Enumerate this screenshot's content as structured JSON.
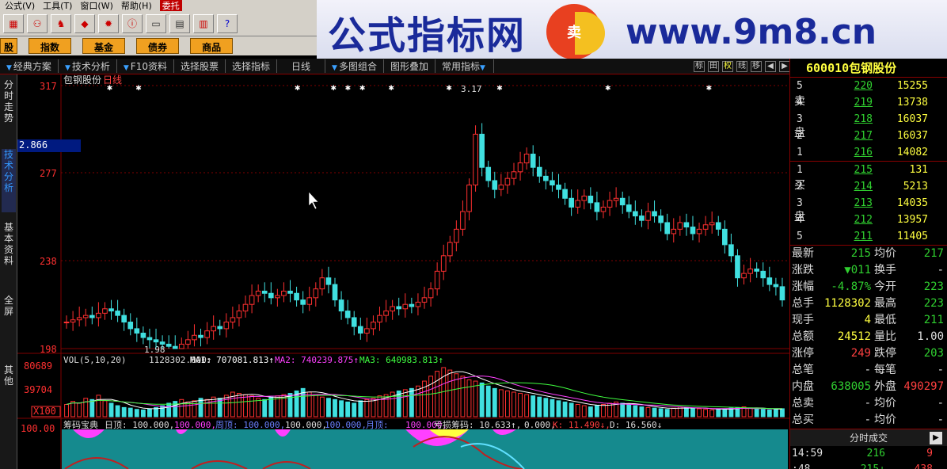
{
  "menubar": {
    "items": [
      "公式(V)",
      "工具(T)",
      "窗口(W)",
      "帮助(H)"
    ],
    "highlight": "委托"
  },
  "toolbar": {
    "icons": [
      "grid-icon",
      "binoculars-icon",
      "stock-icon",
      "diamond-icon",
      "sun-icon",
      "info-icon",
      "window-icon",
      "layout-icon",
      "books-icon",
      "help-cursor-icon"
    ]
  },
  "quickbar": {
    "buttons": [
      "股",
      "指数",
      "基金",
      "债券",
      "商品"
    ]
  },
  "banner": {
    "title": "公式指标网",
    "logo_text": "卖",
    "url": "www.9m8.cn"
  },
  "tabs": [
    "经典方案",
    "技术分析",
    "F10资料",
    "选择股票",
    "选择指标",
    "日线",
    "多图组合",
    "图形叠加",
    "常用指标"
  ],
  "tab_buttons": [
    "标",
    "田",
    "权",
    "线",
    "移"
  ],
  "sidenav": [
    {
      "label": "分时走势",
      "active": false
    },
    {
      "label": "技术分析",
      "active": true
    },
    {
      "label": "基本资料",
      "active": false
    },
    {
      "label": "全屏",
      "active": false
    },
    {
      "label": "其他",
      "active": false
    }
  ],
  "chart": {
    "stock_name": "包钢股份",
    "period": "日线",
    "cursor_value": "2.866",
    "price_axis": [
      "317",
      "277",
      "238",
      "198"
    ],
    "high_label": "3.17",
    "low_label": "1.98",
    "volume": {
      "header": "VOL(5,10,20)",
      "vol": "1128302.000↑",
      "ma1": "MA1: 707081.813↑",
      "ma2": "MA2: 740239.875↑",
      "ma3": "MA3: 640983.813↑",
      "axis": [
        "80689",
        "39704"
      ],
      "unit": "X100"
    },
    "indicator": {
      "axis_top": "100.00",
      "name": "筹码宝典",
      "day_top": "日顶: 100.000,",
      "v1": "100.000,",
      "week_top": "周顶: 100.000,",
      "v2": "100.000,",
      "v3": "100.000,",
      "month_top": "月顶:",
      "v4": "100.000,",
      "loss": "亏损筹码: 10.633↑,",
      "v5": "0.000,",
      "k": "K: 11.490↓,",
      "d": "D: 16.560↓"
    },
    "colors": {
      "up": "#ff3030",
      "down": "#40e0e0",
      "ma1": "#ffffff",
      "ma2": "#ff40ff",
      "ma3": "#40ff40",
      "grid": "#800000"
    }
  },
  "chart_data": {
    "type": "candlestick",
    "title": "包钢股份 日线",
    "ylim": [
      1.98,
      3.17
    ],
    "yticks": [
      3.17,
      2.77,
      2.38,
      1.98
    ],
    "high": 3.17,
    "low": 1.98,
    "close_series": [
      2.1,
      2.11,
      2.12,
      2.13,
      2.12,
      2.14,
      2.16,
      2.15,
      2.13,
      2.1,
      2.07,
      2.05,
      2.03,
      2.02,
      2.01,
      2.0,
      1.99,
      1.98,
      2.0,
      2.02,
      2.04,
      2.03,
      2.06,
      2.08,
      2.07,
      2.1,
      2.12,
      2.15,
      2.18,
      2.22,
      2.24,
      2.23,
      2.21,
      2.22,
      2.24,
      2.23,
      2.2,
      2.18,
      2.21,
      2.25,
      2.3,
      2.27,
      2.2,
      2.15,
      2.12,
      2.08,
      2.05,
      2.07,
      2.1,
      2.13,
      2.15,
      2.17,
      2.16,
      2.18,
      2.17,
      2.19,
      2.21,
      2.25,
      2.33,
      2.4,
      2.46,
      2.52,
      2.6,
      2.72,
      2.95,
      2.8,
      2.74,
      2.7,
      2.72,
      2.75,
      2.78,
      2.82,
      2.86,
      2.8,
      2.76,
      2.74,
      2.72,
      2.7,
      2.66,
      2.62,
      2.65,
      2.67,
      2.64,
      2.6,
      2.62,
      2.65,
      2.66,
      2.63,
      2.6,
      2.58,
      2.56,
      2.6,
      2.58,
      2.55,
      2.5,
      2.52,
      2.55,
      2.53,
      2.5,
      2.52,
      2.54,
      2.55,
      2.52,
      2.45,
      2.4,
      2.3,
      2.32,
      2.34,
      2.33,
      2.3,
      2.27,
      2.26,
      2.2
    ],
    "volume_series": [
      20,
      25,
      22,
      30,
      28,
      35,
      26,
      22,
      18,
      15,
      14,
      12,
      11,
      13,
      15,
      18,
      22,
      25,
      28,
      24,
      26,
      30,
      28,
      32,
      30,
      35,
      40,
      38,
      36,
      34,
      30,
      28,
      32,
      34,
      36,
      38,
      42,
      46,
      40,
      36,
      32,
      30,
      28,
      26,
      24,
      22,
      26,
      28,
      30,
      34,
      36,
      40,
      42,
      44,
      46,
      50,
      58,
      66,
      74,
      80,
      76,
      70,
      66,
      60,
      58,
      55,
      50,
      46,
      44,
      42,
      40,
      38,
      36,
      34,
      32,
      30,
      28,
      26,
      24,
      22,
      20,
      18,
      16,
      18,
      20,
      22,
      24,
      22,
      20,
      18,
      16,
      15,
      14,
      13,
      12,
      14,
      16,
      15,
      14,
      13,
      12,
      11,
      12,
      13,
      14,
      15,
      16,
      14,
      13,
      12,
      11,
      12,
      13
    ],
    "volume": 1128302.0,
    "ma1": 707081.813,
    "ma2": 740239.875,
    "ma3": 640983.813,
    "vol_axis": [
      80689,
      39704
    ]
  },
  "quote": {
    "code_name": "600010包钢股份",
    "sell_label": "卖盘",
    "buy_label": "买盘",
    "sell": [
      {
        "lv": "5",
        "price": "220",
        "vol": "15255"
      },
      {
        "lv": "4",
        "price": "219",
        "vol": "13738"
      },
      {
        "lv": "3",
        "price": "218",
        "vol": "16037"
      },
      {
        "lv": "2",
        "price": "217",
        "vol": "16037"
      },
      {
        "lv": "1",
        "price": "216",
        "vol": "14082"
      }
    ],
    "buy": [
      {
        "lv": "1",
        "price": "215",
        "vol": "131"
      },
      {
        "lv": "2",
        "price": "214",
        "vol": "5213"
      },
      {
        "lv": "3",
        "price": "213",
        "vol": "14035"
      },
      {
        "lv": "4",
        "price": "212",
        "vol": "13957"
      },
      {
        "lv": "5",
        "price": "211",
        "vol": "11405"
      }
    ],
    "stats": [
      {
        "k": "最新",
        "v": "215",
        "vc": "g",
        "k2": "均价",
        "v2": "217",
        "v2c": "g"
      },
      {
        "k": "涨跌",
        "v": "▼011",
        "vc": "g",
        "k2": "换手",
        "v2": "-",
        "v2c": "w"
      },
      {
        "k": "涨幅",
        "v": "-4.87%",
        "vc": "g",
        "k2": "今开",
        "v2": "223",
        "v2c": "g"
      },
      {
        "k": "总手",
        "v": "1128302",
        "vc": "y",
        "k2": "最高",
        "v2": "223",
        "v2c": "g"
      },
      {
        "k": "现手",
        "v": "4",
        "vc": "y",
        "k2": "最低",
        "v2": "211",
        "v2c": "g"
      },
      {
        "k": "总额",
        "v": "24512",
        "vc": "y",
        "k2": "量比",
        "v2": "1.00",
        "v2c": "w"
      },
      {
        "k": "涨停",
        "v": "249",
        "vc": "r",
        "k2": "跌停",
        "v2": "203",
        "v2c": "g"
      },
      {
        "k": "总笔",
        "v": "-",
        "vc": "w",
        "k2": "每笔",
        "v2": "-",
        "v2c": "w"
      },
      {
        "k": "内盘",
        "v": "638005",
        "vc": "g",
        "k2": "外盘",
        "v2": "490297",
        "v2c": "r"
      },
      {
        "k": "总卖",
        "v": "-",
        "vc": "w",
        "k2": "均价",
        "v2": "-",
        "v2c": "w"
      },
      {
        "k": "总买",
        "v": "-",
        "vc": "w",
        "k2": "均价",
        "v2": "-",
        "v2c": "w"
      }
    ],
    "ticks_title": "分时成交",
    "ticks": [
      {
        "t": "14:59",
        "p": "216",
        "n": "9"
      },
      {
        "t": ":48",
        "p": "215↓",
        "n": "438"
      }
    ]
  }
}
